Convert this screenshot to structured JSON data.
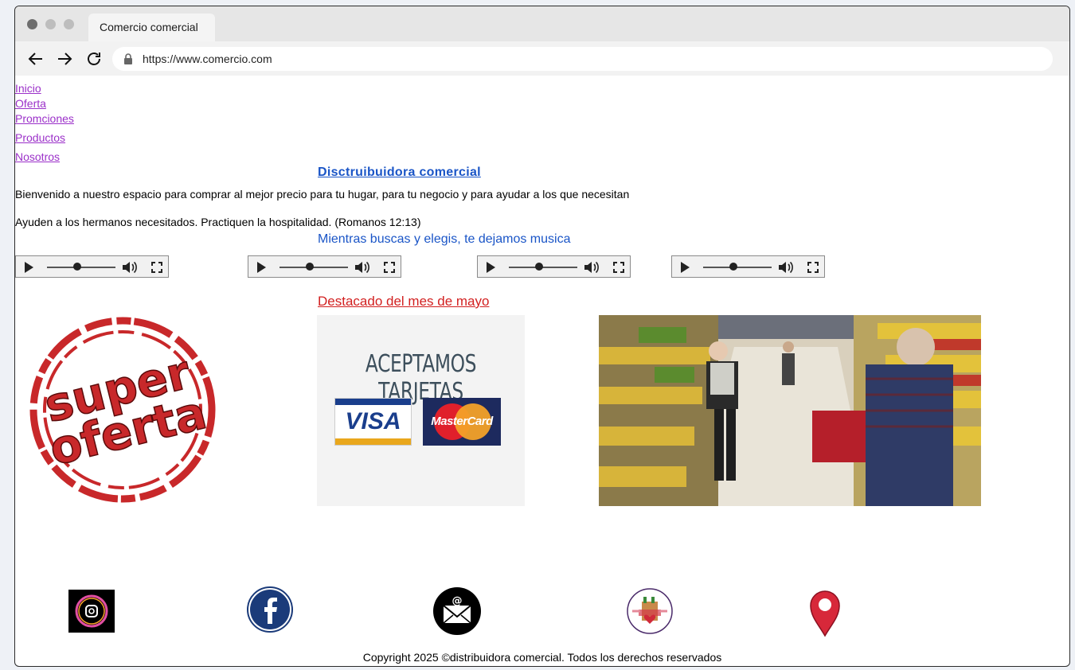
{
  "browser": {
    "tab_title": "Comercio comercial",
    "url": "https://www.comercio.com"
  },
  "nav": {
    "items": [
      "Inicio",
      "Oferta",
      "Promciones",
      "Productos",
      "Nosotros"
    ]
  },
  "main": {
    "title": "Disctruibuidora comercial",
    "welcome": "Bienvenido a nuestro espacio para comprar al mejor precio para tu hugar, para tu negocio y para ayudar a los que necesitan",
    "verse": "Ayuden a los hermanos necesitados. Practiquen la hospitalidad. (Romanos 12:13)",
    "music_heading": "Mientras buscas y elegis, te dejamos musica",
    "featured_heading": "Destacado del mes de mayo",
    "super_offer_text": [
      "super",
      "oferta"
    ],
    "cards_heading": "ACEPTAMOS TARJETAS",
    "visa_label": "VISA",
    "mastercard_label": "MasterCard"
  },
  "footer": {
    "copyright": "Copyright 2025 ©distribuidora comercial. Todos los derechos reservados",
    "social_icons": [
      "instagram-icon",
      "facebook-icon",
      "email-icon",
      "store-logo-icon",
      "location-pin-icon"
    ]
  },
  "colors": {
    "link_visited": "#9b30c9",
    "heading_blue": "#1a55c7",
    "featured_red": "#d21f1f"
  }
}
